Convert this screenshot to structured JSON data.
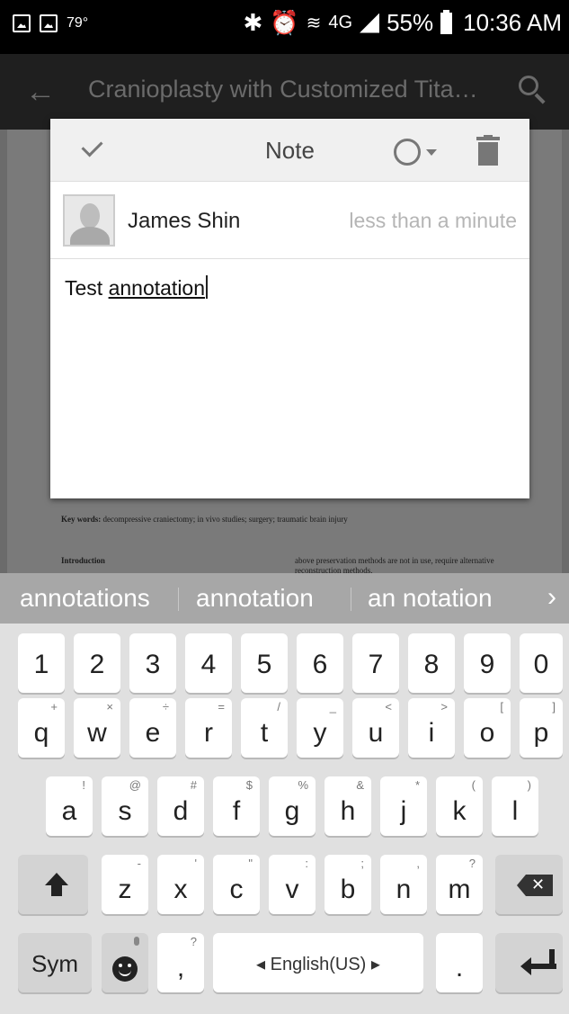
{
  "status_bar": {
    "temperature": "79°",
    "battery": "55%",
    "time": "10:36 AM",
    "network": "4G"
  },
  "app_bar": {
    "title": "Cranioplasty with Customized Tita…"
  },
  "document": {
    "keywords_label": "Key words:",
    "keywords_text": "decompressive craniectomy; in vivo studies; surgery; traumatic brain injury",
    "intro_heading": "Introduction",
    "right_col_text": "above preservation methods are not in use, require alternative reconstruction methods."
  },
  "note": {
    "title": "Note",
    "author": "James Shin",
    "timestamp": "less than a minute",
    "body_word1": "Test",
    "body_word2": "annotation"
  },
  "suggestions": [
    "annotations",
    "annotation",
    "an notation"
  ],
  "keyboard": {
    "numbers": [
      "1",
      "2",
      "3",
      "4",
      "5",
      "6",
      "7",
      "8",
      "9",
      "0"
    ],
    "row1": [
      {
        "key": "q",
        "hint": "+"
      },
      {
        "key": "w",
        "hint": "×"
      },
      {
        "key": "e",
        "hint": "÷"
      },
      {
        "key": "r",
        "hint": "="
      },
      {
        "key": "t",
        "hint": "/"
      },
      {
        "key": "y",
        "hint": "_"
      },
      {
        "key": "u",
        "hint": "<"
      },
      {
        "key": "i",
        "hint": ">"
      },
      {
        "key": "o",
        "hint": "["
      },
      {
        "key": "p",
        "hint": "]"
      }
    ],
    "row2": [
      {
        "key": "a",
        "hint": "!"
      },
      {
        "key": "s",
        "hint": "@"
      },
      {
        "key": "d",
        "hint": "#"
      },
      {
        "key": "f",
        "hint": "$"
      },
      {
        "key": "g",
        "hint": "%"
      },
      {
        "key": "h",
        "hint": "&"
      },
      {
        "key": "j",
        "hint": "*"
      },
      {
        "key": "k",
        "hint": "("
      },
      {
        "key": "l",
        "hint": ")"
      }
    ],
    "row3": [
      {
        "key": "z",
        "hint": "-"
      },
      {
        "key": "x",
        "hint": "'"
      },
      {
        "key": "c",
        "hint": "\""
      },
      {
        "key": "v",
        "hint": ":"
      },
      {
        "key": "b",
        "hint": ";"
      },
      {
        "key": "n",
        "hint": ","
      },
      {
        "key": "m",
        "hint": "?"
      }
    ],
    "sym_label": "Sym",
    "comma": ",",
    "comma_hint": "?",
    "space_label": "◂ English(US) ▸",
    "period": "."
  }
}
